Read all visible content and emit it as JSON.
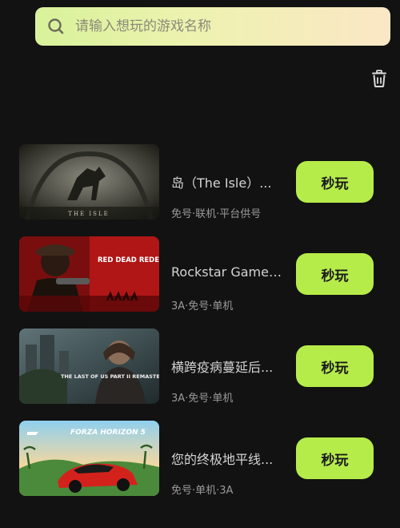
{
  "search": {
    "placeholder": "请输入想玩的游戏名称",
    "icon": "search-icon"
  },
  "history": {
    "clear_icon": "trash-icon"
  },
  "games": [
    {
      "title": "岛（The Isle）...",
      "tags": "免号·联机·平台供号",
      "play_label": "秒玩",
      "thumb_caption": "THE ISLE"
    },
    {
      "title": "Rockstar Games...",
      "tags": "3A·免号·单机",
      "play_label": "秒玩",
      "thumb_caption": "RED DEAD REDEMPTION II"
    },
    {
      "title": "横跨疫病蔓延后...",
      "tags": "3A·免号·单机",
      "play_label": "秒玩",
      "thumb_caption": "THE LAST OF US PART II REMASTERED"
    },
    {
      "title": "您的终极地平线...",
      "tags": "免号·单机·3A",
      "play_label": "秒玩",
      "thumb_caption": "FORZA HORIZON 5"
    }
  ],
  "colors": {
    "background": "#121212",
    "accent": "#b6ec4a"
  }
}
